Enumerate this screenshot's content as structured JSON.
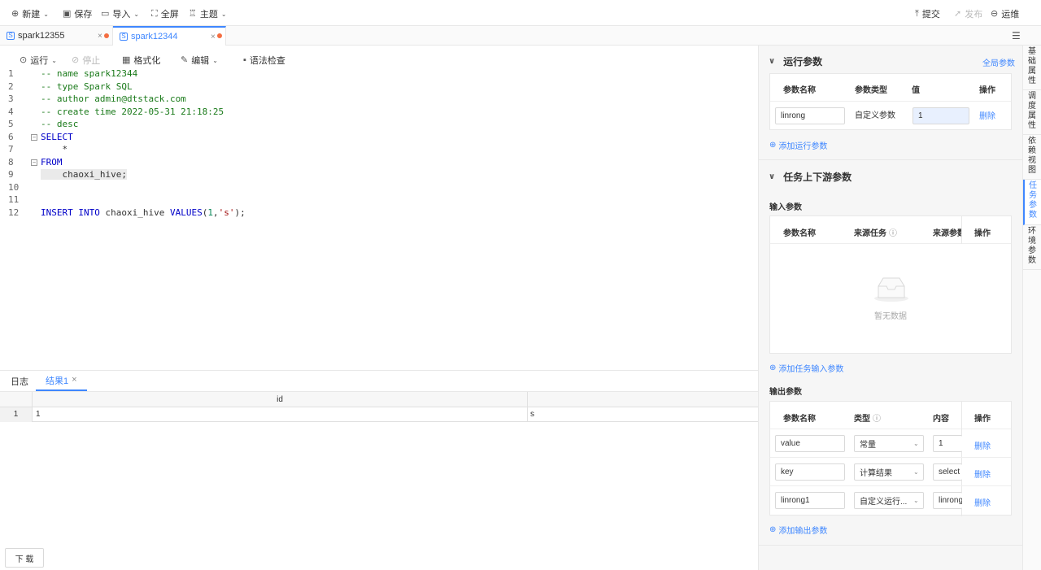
{
  "toolbar": {
    "new": "新建",
    "save": "保存",
    "import": "导入",
    "fullscreen": "全屏",
    "theme": "主题",
    "submit": "提交",
    "publish": "发布",
    "ops": "运维"
  },
  "tabs": [
    {
      "label": "spark12355"
    },
    {
      "label": "spark12344"
    }
  ],
  "editor_toolbar": {
    "run": "运行",
    "stop": "停止",
    "format": "格式化",
    "edit": "编辑",
    "syntax_check": "语法检查"
  },
  "code": {
    "line_numbers": [
      "1",
      "2",
      "3",
      "4",
      "5",
      "6",
      "7",
      "8",
      "9",
      "10",
      "11",
      "12"
    ],
    "l1": "-- name spark12344",
    "l2": "-- type Spark SQL",
    "l3": "-- author admin@dtstack.com",
    "l4": "-- create time 2022-05-31 21:18:25",
    "l5": "-- desc",
    "l6": "SELECT",
    "l7": "    *",
    "l8": "FROM",
    "l9": "    chaoxi_hive;",
    "l12_kw1": "INSERT INTO",
    "l12_tbl": " chaoxi_hive ",
    "l12_kw2": "VALUES",
    "l12_open": "(",
    "l12_num": "1",
    "l12_comma": ",",
    "l12_str": "'s'",
    "l12_close": ");"
  },
  "bottom": {
    "log_tab": "日志",
    "result_tab": "结果1",
    "columns": [
      "id",
      ""
    ],
    "rows": [
      {
        "num": "1",
        "c1": "1",
        "c2": "s"
      }
    ],
    "download": "下 载"
  },
  "run_params": {
    "title": "运行参数",
    "global_link": "全局参数",
    "headers": {
      "name": "参数名称",
      "type": "参数类型",
      "value": "值",
      "op": "操作"
    },
    "row": {
      "name": "linrong",
      "type": "自定义参数",
      "value": "1",
      "op": "删除"
    },
    "add": "添加运行参数"
  },
  "updown_params": {
    "title": "任务上下游参数",
    "input_label": "输入参数",
    "input_headers": {
      "name": "参数名称",
      "source_task": "来源任务",
      "source_param": "来源参数",
      "op": "操作"
    },
    "empty": "暂无数据",
    "add_input": "添加任务输入参数",
    "output_label": "输出参数",
    "output_headers": {
      "name": "参数名称",
      "type": "类型",
      "content": "内容",
      "op": "操作"
    },
    "output_rows": [
      {
        "name": "value",
        "type": "常量",
        "content": "1",
        "op": "删除"
      },
      {
        "name": "key",
        "type": "计算结果",
        "content": "select",
        "op": "删除"
      },
      {
        "name": "linrong1",
        "type": "自定义运行...",
        "content": "linrong",
        "op": "删除"
      }
    ],
    "add_output": "添加输出参数"
  },
  "side_tabs": [
    {
      "label": "基础属性"
    },
    {
      "label": "调度属性"
    },
    {
      "label": "依赖视图"
    },
    {
      "label": "任务参数"
    },
    {
      "label": "环境参数"
    }
  ],
  "colors": {
    "accent": "#3f87ff",
    "dirty_dot": "#f46e42",
    "comment": "#1a7a1a",
    "keyword": "#0000c8"
  }
}
